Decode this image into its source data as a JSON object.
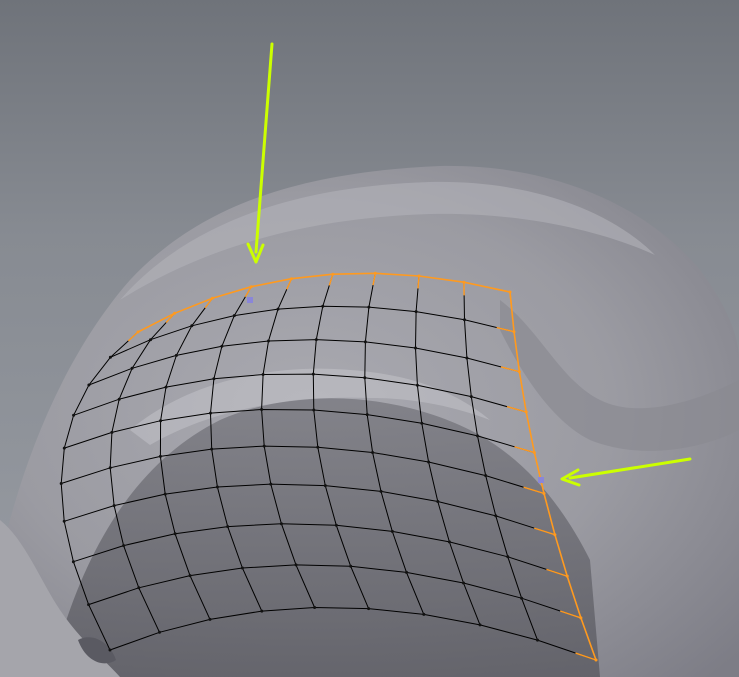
{
  "viewport": {
    "background_color": "#7e8289",
    "mesh_color": "#9b9ba2",
    "grid_line_color": "#000000",
    "boundary_edge_color": "#ff9a1f",
    "arrow_color": "#ccff00",
    "marker_color": "#8a86d8"
  },
  "grid": {
    "rows": 9,
    "cols": 9
  },
  "annotations": [
    {
      "name": "annotation-arrow-top",
      "icon": "arrow-down-icon"
    },
    {
      "name": "annotation-arrow-right",
      "icon": "arrow-left-icon"
    }
  ],
  "markers": [
    {
      "name": "vertex-marker-top"
    },
    {
      "name": "vertex-marker-right"
    }
  ]
}
